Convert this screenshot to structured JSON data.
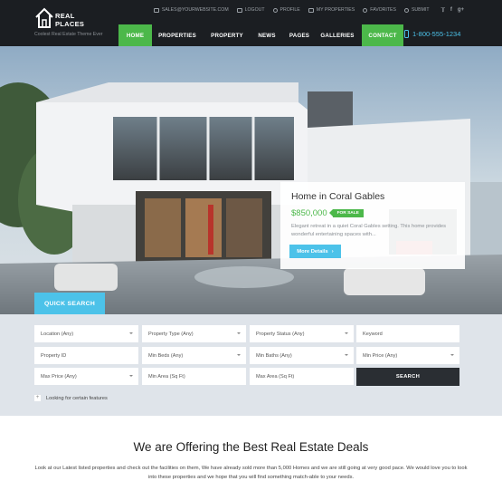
{
  "brand": {
    "name_line1": "REAL",
    "name_line2": "PLACES",
    "tagline": "Coolest Real Estate Theme Ever"
  },
  "topbar": {
    "email": "SALES@YOURWEBSITE.COM",
    "logout": "LOGOUT",
    "profile": "PROFILE",
    "my_properties": "MY PROPERTIES",
    "favorites": "FAVORITES",
    "submit": "SUBMIT",
    "social": [
      "twitter-icon",
      "facebook-icon",
      "google-plus-icon"
    ]
  },
  "nav": {
    "items": [
      "HOME",
      "PROPERTIES",
      "PROPERTY",
      "NEWS",
      "PAGES",
      "GALLERIES"
    ],
    "contact": "CONTACT",
    "phone": "1-800-555-1234"
  },
  "hero": {
    "title": "Home in Coral Gables",
    "price": "$850,000",
    "badge": "FOR SALE",
    "description": "Elegant retreat in a quiet Coral Gables setting. This home provides wonderful entertaining spaces with...",
    "button": "More Details"
  },
  "search": {
    "tab": "QUICK SEARCH",
    "fields": {
      "location": "Location (Any)",
      "property_type": "Property Type (Any)",
      "property_status": "Property Status (Any)",
      "keyword": "Keyword",
      "property_id": "Property ID",
      "min_beds": "Min Beds (Any)",
      "min_baths": "Min Baths (Any)",
      "min_price": "Min Price (Any)",
      "max_price": "Max Price (Any)",
      "min_area": "Min Area (Sq Ft)",
      "max_area": "Max Area (Sq Ft)"
    },
    "button": "SEARCH",
    "features": "Looking for certain features"
  },
  "section": {
    "heading": "We are Offering the Best Real Estate Deals",
    "text": "Look at our Latest listed properties and check out the facilities on them, We have already sold more than 5,000 Homes and we are still going at very good pace. We would love you to look into these properties and we hope that you will find something match-able to your needs."
  },
  "colors": {
    "green": "#4cb84a",
    "blue": "#4cc2e9",
    "header": "#1b1e22",
    "search_bg": "#dfe4ea"
  }
}
